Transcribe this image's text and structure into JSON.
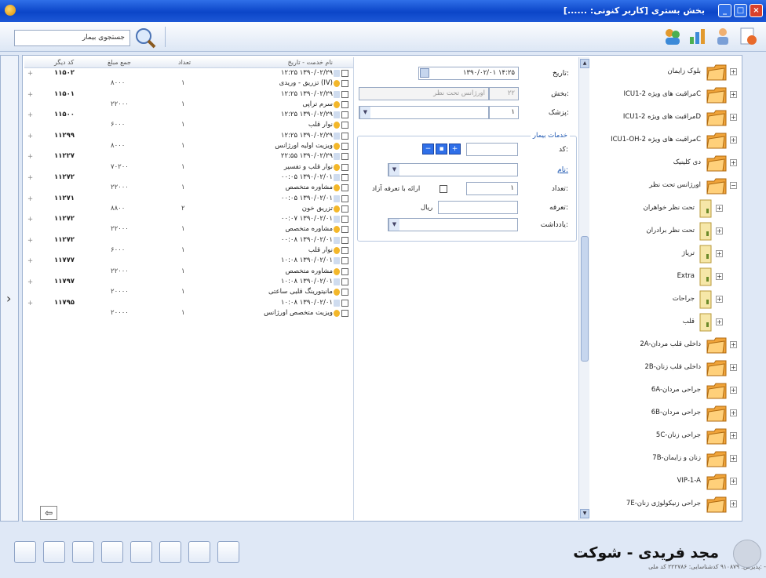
{
  "window": {
    "title": "بخش بستری [کاربر کنونی: ......]",
    "close": "×",
    "maximize": "□",
    "minimize": "_"
  },
  "toolbar": {
    "search_label": "جستجوی بیمار",
    "search_icon": "search-icon"
  },
  "grid": {
    "headers": {
      "desc": "نام خدمت - تاریخ",
      "qty": "تعداد",
      "amount": "جمع مبلغ",
      "code": "کد دیگر"
    },
    "rows": [
      {
        "plus": "+",
        "code": "۱۱۵۰۲",
        "amount": "",
        "qty": "",
        "desc": "۱۲:۲۵ ۱۳۹۰/۰۲/۲۹"
      },
      {
        "plus": "",
        "code": "",
        "amount": "۸۰۰۰",
        "qty": "۱",
        "desc": "تزریق - وریدی (IV)"
      },
      {
        "plus": "+",
        "code": "۱۱۵۰۱",
        "amount": "",
        "qty": "",
        "desc": "۱۲:۲۵ ۱۳۹۰/۰۲/۲۹"
      },
      {
        "plus": "",
        "code": "",
        "amount": "۲۲۰۰۰",
        "qty": "۱",
        "desc": "سرم تراپی"
      },
      {
        "plus": "+",
        "code": "۱۱۵۰۰",
        "amount": "",
        "qty": "",
        "desc": "۱۲:۲۵ ۱۳۹۰/۰۲/۲۹"
      },
      {
        "plus": "",
        "code": "",
        "amount": "۶۰۰۰",
        "qty": "۱",
        "desc": "نوار قلب"
      },
      {
        "plus": "+",
        "code": "۱۱۲۹۹",
        "amount": "",
        "qty": "",
        "desc": "۱۲:۲۵ ۱۳۹۰/۰۲/۲۹"
      },
      {
        "plus": "",
        "code": "",
        "amount": "۸۰۰۰",
        "qty": "۱",
        "desc": "ویزیت اولیه اورژانس"
      },
      {
        "plus": "+",
        "code": "۱۱۲۲۷",
        "amount": "",
        "qty": "",
        "desc": "۲۲:۵۵ ۱۳۹۰/۰۲/۲۹"
      },
      {
        "plus": "",
        "code": "",
        "amount": "۷۰۲۰۰",
        "qty": "۱",
        "desc": "نوار قلب و تفسیر"
      },
      {
        "plus": "+",
        "code": "۱۱۲۷۲",
        "amount": "",
        "qty": "",
        "desc": "۰۰:۰۵ ۱۳۹۰/۰۲/۰۱"
      },
      {
        "plus": "",
        "code": "",
        "amount": "۲۲۰۰۰",
        "qty": "۱",
        "desc": "مشاوره متخصص"
      },
      {
        "plus": "+",
        "code": "۱۱۲۷۱",
        "amount": "",
        "qty": "",
        "desc": "۰۰:۰۵ ۱۳۹۰/۰۲/۰۱"
      },
      {
        "plus": "",
        "code": "",
        "amount": "۸۸۰۰",
        "qty": "۲",
        "desc": "تزریق خون"
      },
      {
        "plus": "+",
        "code": "۱۱۲۷۲",
        "amount": "",
        "qty": "",
        "desc": "۰۰:۰۷ ۱۳۹۰/۰۲/۰۱"
      },
      {
        "plus": "",
        "code": "",
        "amount": "۲۲۰۰۰",
        "qty": "۱",
        "desc": "مشاوره متخصص"
      },
      {
        "plus": "+",
        "code": "۱۱۲۷۲",
        "amount": "",
        "qty": "",
        "desc": "۰۰:۰۸ ۱۳۹۰/۰۲/۰۱"
      },
      {
        "plus": "",
        "code": "",
        "amount": "۶۰۰۰",
        "qty": "۱",
        "desc": "نوار قلب"
      },
      {
        "plus": "+",
        "code": "۱۱۷۷۷",
        "amount": "",
        "qty": "",
        "desc": "۱۰:۰۸ ۱۳۹۰/۰۲/۰۱"
      },
      {
        "plus": "",
        "code": "",
        "amount": "۲۲۰۰۰",
        "qty": "۱",
        "desc": "مشاوره متخصص"
      },
      {
        "plus": "+",
        "code": "۱۱۷۹۷",
        "amount": "",
        "qty": "",
        "desc": "۱۰:۰۸ ۱۳۹۰/۰۲/۰۱"
      },
      {
        "plus": "",
        "code": "",
        "amount": "۲۰۰۰۰",
        "qty": "۱",
        "desc": "مانیتورینگ قلبی ساعتی"
      },
      {
        "plus": "+",
        "code": "۱۱۷۹۵",
        "amount": "",
        "qty": "",
        "desc": "۱۰:۰۸ ۱۳۹۰/۰۲/۰۱"
      },
      {
        "plus": "",
        "code": "",
        "amount": "۲۰۰۰۰",
        "qty": "۱",
        "desc": "ویزیت متخصص اورژانس"
      }
    ]
  },
  "form": {
    "date_label": "تاریخ:",
    "date_value": "۱۳۹۰/۰۲/۰۱ ۱۴:۲۵",
    "section_label": "بخش:",
    "section_code": "۲۲",
    "section_name": "اورژانس تحت نظر",
    "doctor_label": "پزشک:",
    "doctor_code": "۱",
    "group_title": "خدمات بیمار",
    "code_label": "کد:",
    "name_label": "نام:",
    "qty_label": "تعداد:",
    "qty_value": "۱",
    "free_label": "ارائه با تعرفه آزاد",
    "tariff_label": "تعرفه:",
    "rial_label": "ریال",
    "note_label": "یادداشت:"
  },
  "tree": {
    "items": [
      {
        "label": "بلوک زایمان",
        "exp": "+",
        "child": false
      },
      {
        "label": "ICU1-مراقبت های ویژه 2C",
        "exp": "+",
        "child": false
      },
      {
        "label": "ICU1-مراقبت های ویژه 2D",
        "exp": "+",
        "child": false
      },
      {
        "label": "ICU1-OH-مراقبت های ویژه 2C",
        "exp": "+",
        "child": false
      },
      {
        "label": "دی کلینیک",
        "exp": "+",
        "child": false
      },
      {
        "label": "اورژانس تحت نظر",
        "exp": "−",
        "child": false
      },
      {
        "label": "تحت نظر خواهران",
        "exp": "+",
        "child": true
      },
      {
        "label": "تحت نظر برادران",
        "exp": "+",
        "child": true
      },
      {
        "label": "تریاژ",
        "exp": "+",
        "child": true
      },
      {
        "label": "Extra",
        "exp": "+",
        "child": true
      },
      {
        "label": "جراحات",
        "exp": "+",
        "child": true
      },
      {
        "label": "قلب",
        "exp": "+",
        "child": true
      },
      {
        "label": "2A-داخلی قلب مردان",
        "exp": "+",
        "child": false
      },
      {
        "label": "2B-داخلی قلب زنان",
        "exp": "+",
        "child": false
      },
      {
        "label": "6A-جراحی مردان",
        "exp": "+",
        "child": false
      },
      {
        "label": "6B-جراحی مردان",
        "exp": "+",
        "child": false
      },
      {
        "label": "5C-جراحی زنان",
        "exp": "+",
        "child": false
      },
      {
        "label": "7B-زنان و زایمان",
        "exp": "+",
        "child": false
      },
      {
        "label": "VIP-1-A",
        "exp": "+",
        "child": false
      },
      {
        "label": "7E-جراحی زنیکولوژی زنان",
        "exp": "+",
        "child": false
      }
    ]
  },
  "patient": {
    "name": "مجد فریدی - شوکت",
    "info": "پذیرش: ۹۱۰۸۷۹   کدشناسایی: ۲۲۲۷۸۶   کد ملی: -"
  },
  "colors": {
    "titlebar": "#0b45c8",
    "accent": "#2f6fe8",
    "panel_bg": "#dfe8f6"
  }
}
